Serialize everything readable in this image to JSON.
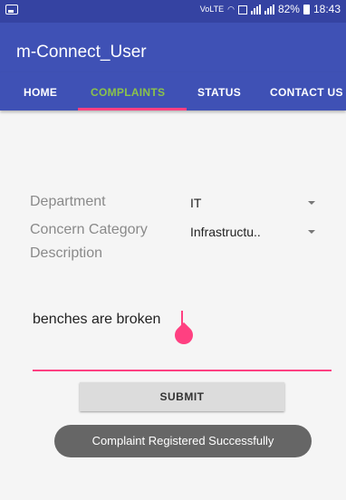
{
  "status_bar": {
    "battery": "82%",
    "time": "18:43",
    "volte": "VoLTE"
  },
  "app": {
    "title": "m-Connect_User"
  },
  "tabs": [
    {
      "label": "HOME"
    },
    {
      "label": "COMPLAINTS"
    },
    {
      "label": "STATUS"
    },
    {
      "label": "CONTACT US"
    }
  ],
  "form": {
    "department_label": "Department",
    "department_value": "IT",
    "category_label": "Concern Category",
    "category_value": "Infrastructu..",
    "description_label": "Description",
    "description_value": "benches are broken",
    "submit_label": "SUBMIT"
  },
  "toast": {
    "message": "Complaint Registered Successfully"
  },
  "colors": {
    "primary": "#3f51b5",
    "status_bar": "#3543a2",
    "accent": "#ff4081",
    "active_tab": "#8bc34a"
  }
}
